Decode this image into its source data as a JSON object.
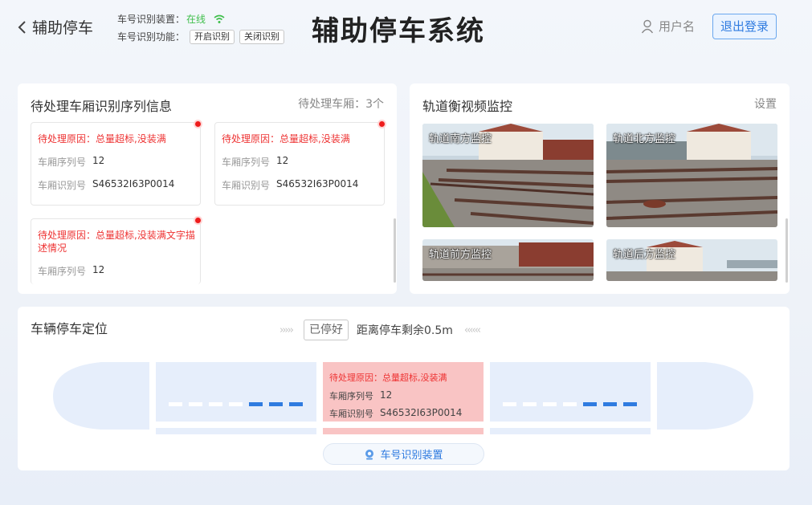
{
  "header": {
    "back_label": "辅助停车",
    "device_label": "车号识别装置：",
    "device_status": "在线",
    "function_label": "车号识别功能：",
    "enable_label": "开启识别",
    "disable_label": "关闭识别",
    "title": "辅助停车系统",
    "username": "用户名",
    "logout_label": "退出登录"
  },
  "pending": {
    "title": "待处理车厢识别序列信息",
    "count_text": "待处理车厢：3个",
    "seq_label": "车厢序列号",
    "id_label": "车厢识别号",
    "cards": [
      {
        "reason": "待处理原因：总量超标,没装满",
        "seq": "12",
        "id": "S46532I63P0014"
      },
      {
        "reason": "待处理原因：总量超标,没装满",
        "seq": "12",
        "id": "S46532I63P0014"
      },
      {
        "reason": "待处理原因：总量超标,没装满文字描述情况",
        "seq": "12",
        "id": ""
      }
    ]
  },
  "monitor": {
    "title": "轨道衡视频监控",
    "settings_label": "设置",
    "cameras": [
      {
        "label": "轨道南方监控"
      },
      {
        "label": "轨道北方监控"
      },
      {
        "label": "轨道前方监控"
      },
      {
        "label": "轨道后方监控"
      }
    ]
  },
  "parking": {
    "title": "车辆停车定位",
    "stopped_label": "已停好",
    "distance_text": "距离停车剩余0.5m",
    "left_arrows": "›››››",
    "right_arrows": "‹‹‹‹‹‹",
    "active": {
      "reason": "待处理原因：总量超标,没装满",
      "seq_label": "车厢序列号",
      "seq": "12",
      "id_label": "车厢识别号",
      "id": "S46532I63P0014"
    },
    "recog_button": "车号识别装置"
  },
  "colors": {
    "accent": "#2f7be0",
    "online": "#3fbf4b",
    "alert": "#ee3333",
    "active_car": "#f9c4c4",
    "car": "#e6eefb"
  }
}
